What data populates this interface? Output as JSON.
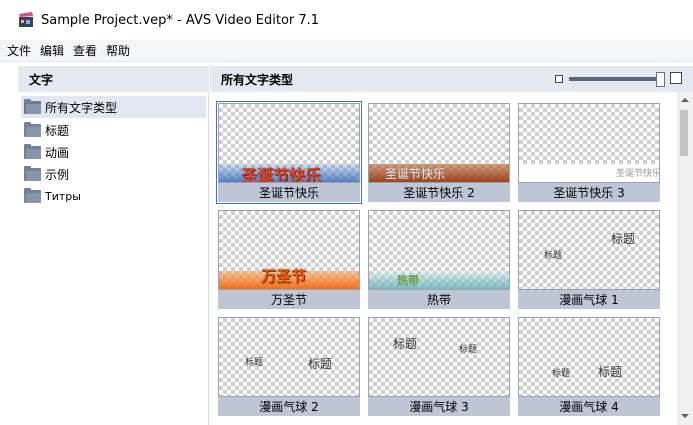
{
  "window": {
    "title": "Sample Project.vep* - AVS Video Editor 7.1",
    "icon": "film-clapper-icon"
  },
  "menu": [
    "文件",
    "编辑",
    "查看",
    "帮助"
  ],
  "sidebar": {
    "title": "文字",
    "items": [
      {
        "label": "所有文字类型",
        "selected": true
      },
      {
        "label": "标题"
      },
      {
        "label": "动画"
      },
      {
        "label": "示例"
      },
      {
        "label": "Титры"
      }
    ]
  },
  "main": {
    "title": "所有文字类型",
    "zoom": {
      "min_icon": "small-square-icon",
      "max_icon": "large-square-icon",
      "level": 0.95
    },
    "tiles": [
      {
        "label": "圣诞节快乐",
        "preview_text": [
          "圣诞节快乐"
        ],
        "selected": true
      },
      {
        "label": "圣诞节快乐 2",
        "preview_text": [
          "圣诞节快乐"
        ]
      },
      {
        "label": "圣诞节快乐 3",
        "preview_text": [
          "圣诞节快乐"
        ]
      },
      {
        "label": "万圣节",
        "preview_text": [
          "万圣节"
        ]
      },
      {
        "label": "热带",
        "preview_text": [
          "热带"
        ]
      },
      {
        "label": "漫画气球 1",
        "preview_text": [
          "标题",
          "标题"
        ]
      },
      {
        "label": "漫画气球 2",
        "preview_text": [
          "标题",
          "标题"
        ]
      },
      {
        "label": "漫画气球 3",
        "preview_text": [
          "标题",
          "标题"
        ]
      },
      {
        "label": "漫画气球 4",
        "preview_text": [
          "标题",
          "标题"
        ]
      }
    ]
  }
}
